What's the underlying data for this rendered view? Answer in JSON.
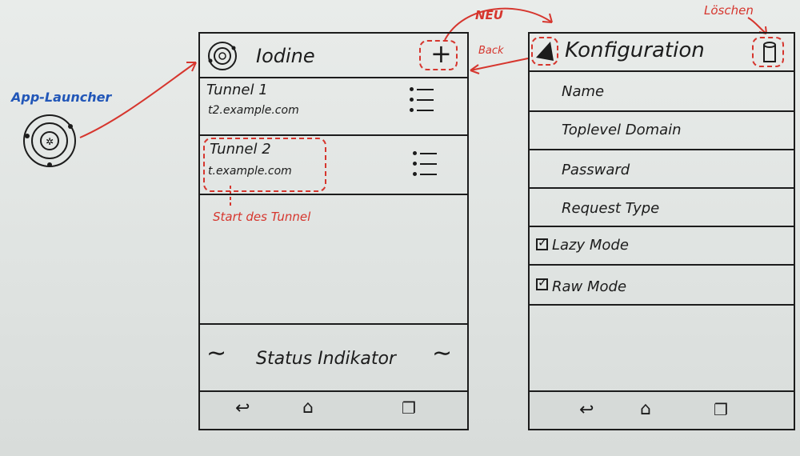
{
  "launcher": {
    "label": "App-Launcher"
  },
  "left_screen": {
    "title": "Iodine",
    "tunnels": [
      {
        "name": "Tunnel 1",
        "host": "t2.example.com"
      },
      {
        "name": "Tunnel 2",
        "host": "t.example.com"
      }
    ],
    "status": "Status Indikator"
  },
  "right_screen": {
    "title": "Konfiguration",
    "fields": [
      "Name",
      "Toplevel Domain",
      "Passward",
      "Request Type"
    ],
    "options": [
      {
        "label": "Lazy Mode",
        "checked": true
      },
      {
        "label": "Raw Mode",
        "checked": true
      }
    ]
  },
  "annotations": {
    "new": "NEU",
    "back": "Back",
    "delete": "Löschen",
    "start_tunnel": "Start des Tunnel"
  },
  "colors": {
    "annotation_red": "#d6362e",
    "annotation_blue": "#2156b8",
    "marker": "#1c1c1c"
  }
}
